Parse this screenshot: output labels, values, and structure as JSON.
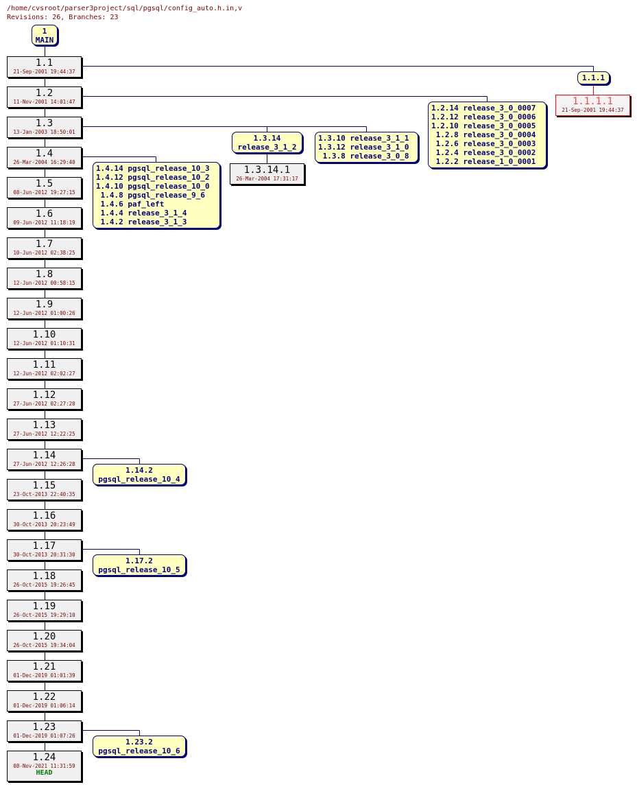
{
  "header": {
    "path": "/home/cvsroot/parser3project/sql/pgsql/config_auto.h.in,v",
    "summary": "Revisions: 26, Branches: 23"
  },
  "main_node": {
    "number": "1",
    "name": "MAIN"
  },
  "trunk": [
    {
      "rev": "1.1",
      "date": "21-Sep-2001 19:44:37"
    },
    {
      "rev": "1.2",
      "date": "11-Nov-2001 14:01:47"
    },
    {
      "rev": "1.3",
      "date": "13-Jan-2003 18:50:01"
    },
    {
      "rev": "1.4",
      "date": "26-Mar-2004 16:29:40"
    },
    {
      "rev": "1.5",
      "date": "08-Jun-2012 19:27:15"
    },
    {
      "rev": "1.6",
      "date": "09-Jun-2012 11:18:19"
    },
    {
      "rev": "1.7",
      "date": "10-Jun-2012 02:38:25"
    },
    {
      "rev": "1.8",
      "date": "12-Jun-2012 00:58:15"
    },
    {
      "rev": "1.9",
      "date": "12-Jun-2012 01:00:26"
    },
    {
      "rev": "1.10",
      "date": "12-Jun-2012 01:10:31"
    },
    {
      "rev": "1.11",
      "date": "12-Jun-2012 02:02:27"
    },
    {
      "rev": "1.12",
      "date": "27-Jun-2012 02:27:20"
    },
    {
      "rev": "1.13",
      "date": "27-Jun-2012 12:22:25"
    },
    {
      "rev": "1.14",
      "date": "27-Jun-2012 12:26:28"
    },
    {
      "rev": "1.15",
      "date": "23-Oct-2013 22:40:35"
    },
    {
      "rev": "1.16",
      "date": "30-Oct-2013 20:23:49"
    },
    {
      "rev": "1.17",
      "date": "30-Oct-2013 20:31:30"
    },
    {
      "rev": "1.18",
      "date": "26-Oct-2015 19:26:45"
    },
    {
      "rev": "1.19",
      "date": "26-Oct-2015 19:29:10"
    },
    {
      "rev": "1.20",
      "date": "26-Oct-2015 19:34:04"
    },
    {
      "rev": "1.21",
      "date": "01-Dec-2019 01:01:39"
    },
    {
      "rev": "1.22",
      "date": "01-Dec-2019 01:06:14"
    },
    {
      "rev": "1.23",
      "date": "01-Dec-2019 01:07:26"
    },
    {
      "rev": "1.24",
      "date": "08-Nov-2021 11:31:59",
      "tag": "HEAD"
    }
  ],
  "branches": {
    "b_1_1_1": {
      "lines": [
        "1.1.1"
      ]
    },
    "b_1_2": {
      "lines": [
        "1.2.14 release_3_0_0007",
        "1.2.12 release_3_0_0006",
        "1.2.10 release_3_0_0005",
        " 1.2.8 release_3_0_0004",
        " 1.2.6 release_3_0_0003",
        " 1.2.4 release_3_0_0002",
        " 1.2.2 release_1_0_0001"
      ]
    },
    "b_1_3_14": {
      "lines": [
        "1.3.14",
        "release_3_1_2"
      ]
    },
    "b_1_3": {
      "lines": [
        "1.3.10 release_3_1_1",
        "1.3.12 release_3_1_0",
        " 1.3.8 release_3_0_8"
      ]
    },
    "b_1_4": {
      "lines": [
        "1.4.14 pgsql_release_10_3",
        "1.4.12 pgsql_release_10_2",
        "1.4.10 pgsql_release_10_0",
        " 1.4.8 pgsql_release_9_6",
        " 1.4.6 paf_left",
        " 1.4.4 release_3_1_4",
        " 1.4.2 release_3_1_3"
      ]
    },
    "b_1_14_2": {
      "lines": [
        "1.14.2",
        "pgsql_release_10_4"
      ]
    },
    "b_1_17_2": {
      "lines": [
        "1.17.2",
        "pgsql_release_10_5"
      ]
    },
    "b_1_23_2": {
      "lines": [
        "1.23.2",
        "pgsql_release_10_6"
      ]
    }
  },
  "branch_revs": {
    "r_1_1_1_1": {
      "rev": "1.1.1.1",
      "date": "21-Sep-2001 19:44:37"
    },
    "r_1_3_14_1": {
      "rev": "1.3.14.1",
      "date": "26-Mar-2004 17:31:17"
    }
  },
  "colors": {
    "line": "#000080",
    "branch_fill": "#ffffc0",
    "rev_fill": "#f0f0f0",
    "date": "#800000",
    "dead": "#ff0000",
    "head": "#008000"
  }
}
